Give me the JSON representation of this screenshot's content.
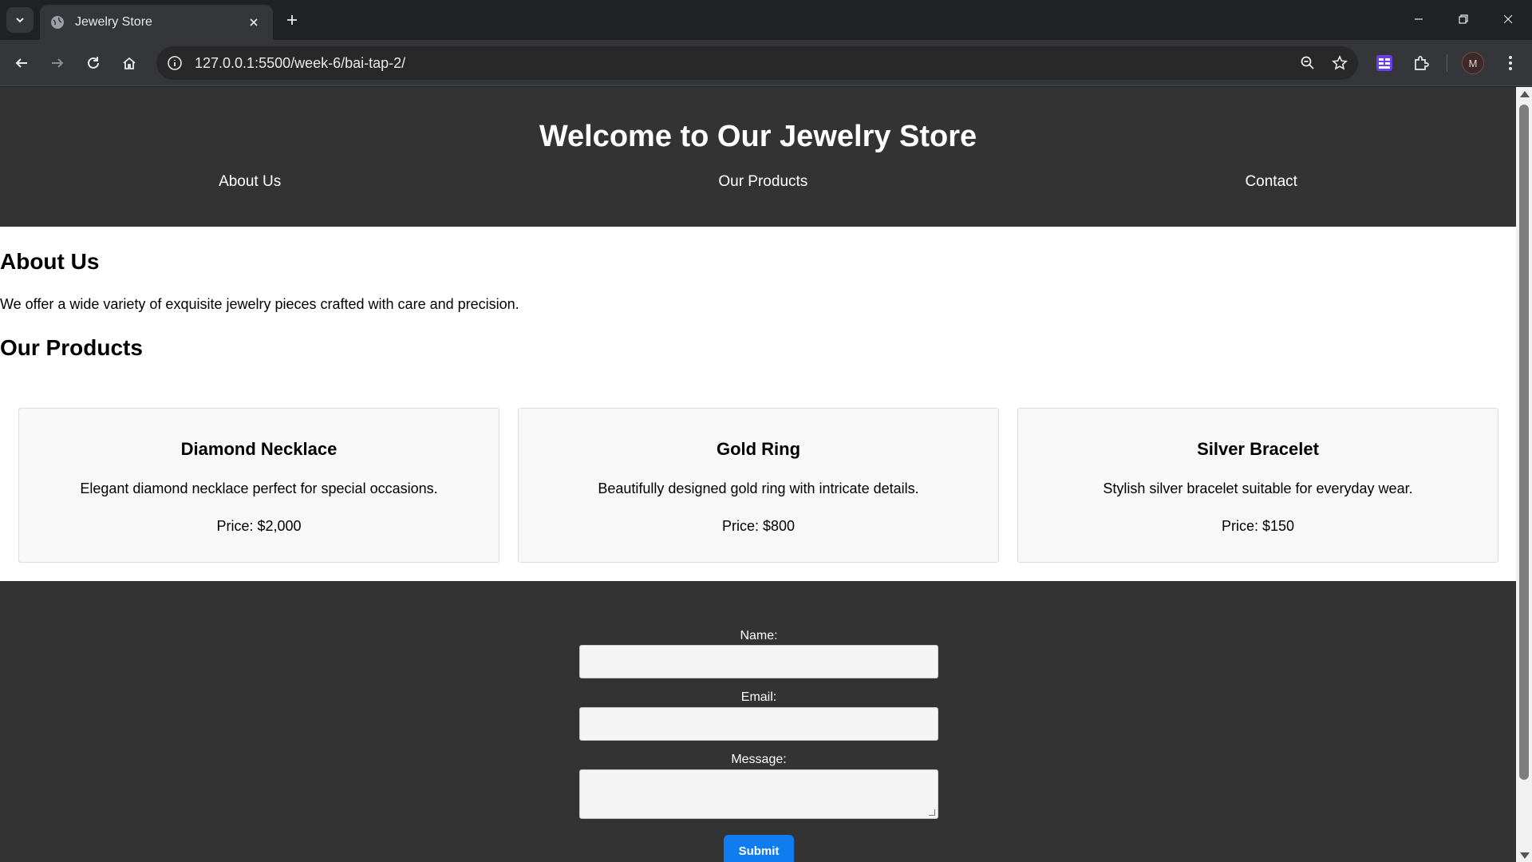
{
  "browser": {
    "tab_title": "Jewelry Store",
    "url": "127.0.0.1:5500/week-6/bai-tap-2/",
    "avatar_letter": "M"
  },
  "site": {
    "title": "Welcome to Our Jewelry Store",
    "nav": [
      "About Us",
      "Our Products",
      "Contact"
    ]
  },
  "about": {
    "heading": "About Us",
    "text": "We offer a wide variety of exquisite jewelry pieces crafted with care and precision."
  },
  "products": {
    "heading": "Our Products",
    "items": [
      {
        "name": "Diamond Necklace",
        "description": "Elegant diamond necklace perfect for special occasions.",
        "price": "Price: $2,000"
      },
      {
        "name": "Gold Ring",
        "description": "Beautifully designed gold ring with intricate details.",
        "price": "Price: $800"
      },
      {
        "name": "Silver Bracelet",
        "description": "Stylish silver bracelet suitable for everyday wear.",
        "price": "Price: $150"
      }
    ]
  },
  "contact_form": {
    "name_label": "Name:",
    "name_value": "",
    "email_label": "Email:",
    "email_value": "",
    "message_label": "Message:",
    "message_value": "",
    "submit_label": "Submit"
  },
  "colors": {
    "header_bg": "#333333",
    "submit_bg": "#0f7cf0",
    "card_bg": "#f8f8f8"
  }
}
